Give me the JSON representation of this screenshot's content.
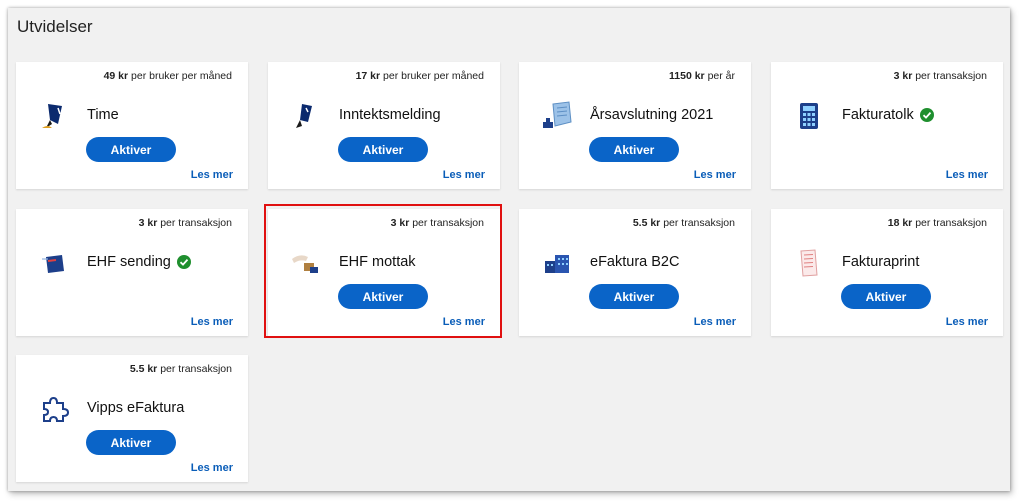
{
  "title": "Utvidelser",
  "colors": {
    "accent": "#0a64c8",
    "link": "#0a5db8",
    "success": "#1f8f2e",
    "highlight": "#e01010"
  },
  "cards": [
    {
      "price": "49 kr",
      "unit": "per bruker per måned",
      "name": "Time",
      "button": "Aktiver",
      "link": "Les mer",
      "icon": "pen-writing-icon",
      "active": false
    },
    {
      "price": "17 kr",
      "unit": "per bruker per måned",
      "name": "Inntektsmelding",
      "button": "Aktiver",
      "link": "Les mer",
      "icon": "hand-document-icon",
      "active": false
    },
    {
      "price": "1150 kr",
      "unit": "per år",
      "name": "Årsavslutning 2021",
      "button": "Aktiver",
      "link": "Les mer",
      "icon": "document-stamp-icon",
      "active": false
    },
    {
      "price": "3 kr",
      "unit": "per transaksjon",
      "name": "Fakturatolk",
      "button": "",
      "link": "Les mer",
      "icon": "calculator-icon",
      "active": true
    },
    {
      "price": "3 kr",
      "unit": "per transaksjon",
      "name": "EHF sending",
      "button": "",
      "link": "Les mer",
      "icon": "envelope-send-icon",
      "active": true
    },
    {
      "price": "3 kr",
      "unit": "per transaksjon",
      "name": "EHF mottak",
      "button": "Aktiver",
      "link": "Les mer",
      "icon": "hand-receive-icon",
      "active": false
    },
    {
      "price": "5.5 kr",
      "unit": "per transaksjon",
      "name": "eFaktura B2C",
      "button": "Aktiver",
      "link": "Les mer",
      "icon": "building-icon",
      "active": false
    },
    {
      "price": "18 kr",
      "unit": "per transaksjon",
      "name": "Fakturaprint",
      "button": "Aktiver",
      "link": "Les mer",
      "icon": "printed-invoice-icon",
      "active": false
    },
    {
      "price": "5.5 kr",
      "unit": "per transaksjon",
      "name": "Vipps eFaktura",
      "button": "Aktiver",
      "link": "Les mer",
      "icon": "puzzle-piece-icon",
      "active": false
    }
  ]
}
